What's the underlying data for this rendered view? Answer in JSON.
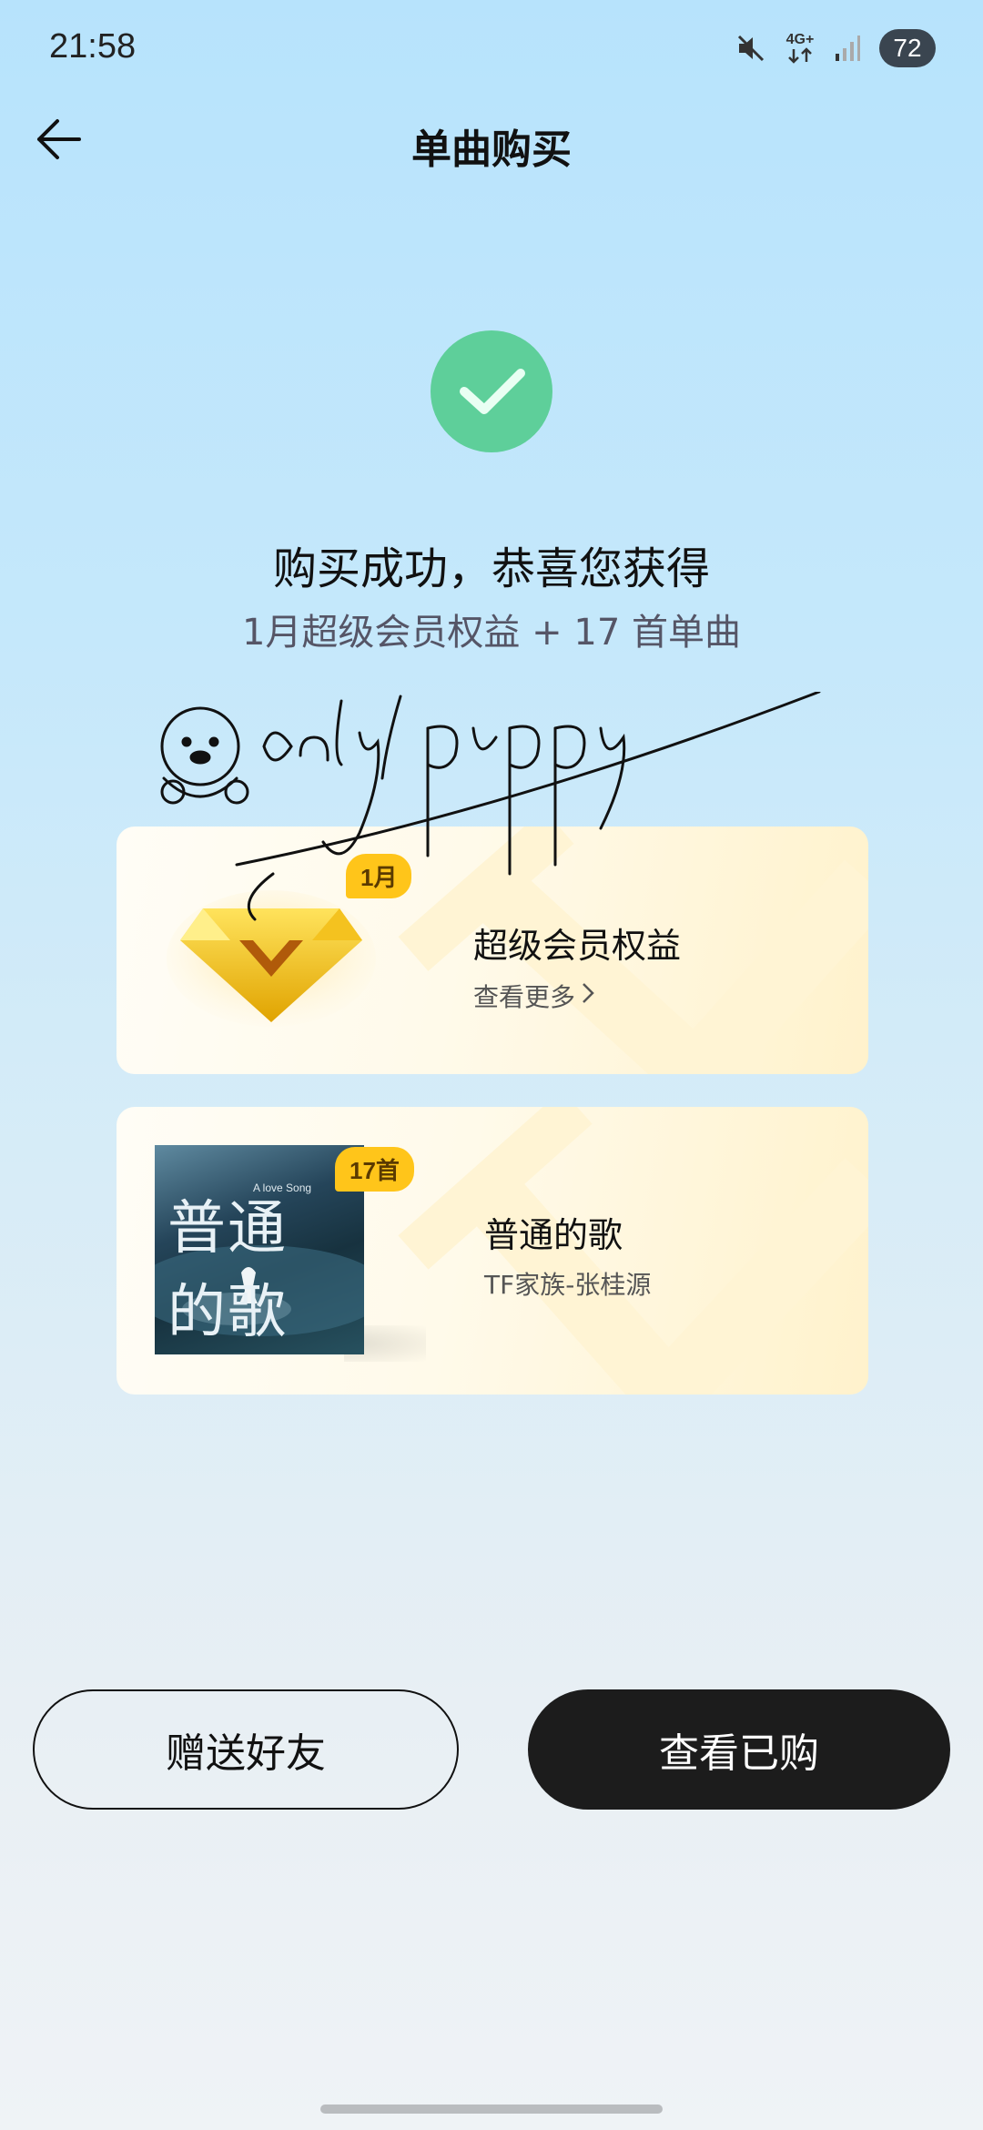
{
  "status_bar": {
    "time": "21:58",
    "network": "4G+",
    "battery": "72",
    "icons": [
      "mute-icon",
      "network-icon",
      "signal-icon",
      "battery-icon"
    ]
  },
  "header": {
    "back_icon": "arrow-left-icon",
    "title": "单曲购买"
  },
  "success": {
    "icon": "check-circle-icon",
    "title": "购买成功，恭喜您获得",
    "subtitle": "1月超级会员权益 + 17 首单曲"
  },
  "watermark": {
    "text": "only1puppy"
  },
  "vip_card": {
    "badge": "1月",
    "title": "超级会员权益",
    "more_label": "查看更多",
    "icon": "diamond-icon"
  },
  "song_card": {
    "badge": "17首",
    "title": "普通的歌",
    "artist": "TF家族-张桂源",
    "cover_title": "普通 的歌",
    "cover_small": "A love Song"
  },
  "actions": {
    "gift_label": "赠送好友",
    "view_label": "查看已购"
  },
  "colors": {
    "success_green": "#5ecf9a",
    "badge_gold": "#ffc51a",
    "primary_button": "#1c1c1c"
  }
}
